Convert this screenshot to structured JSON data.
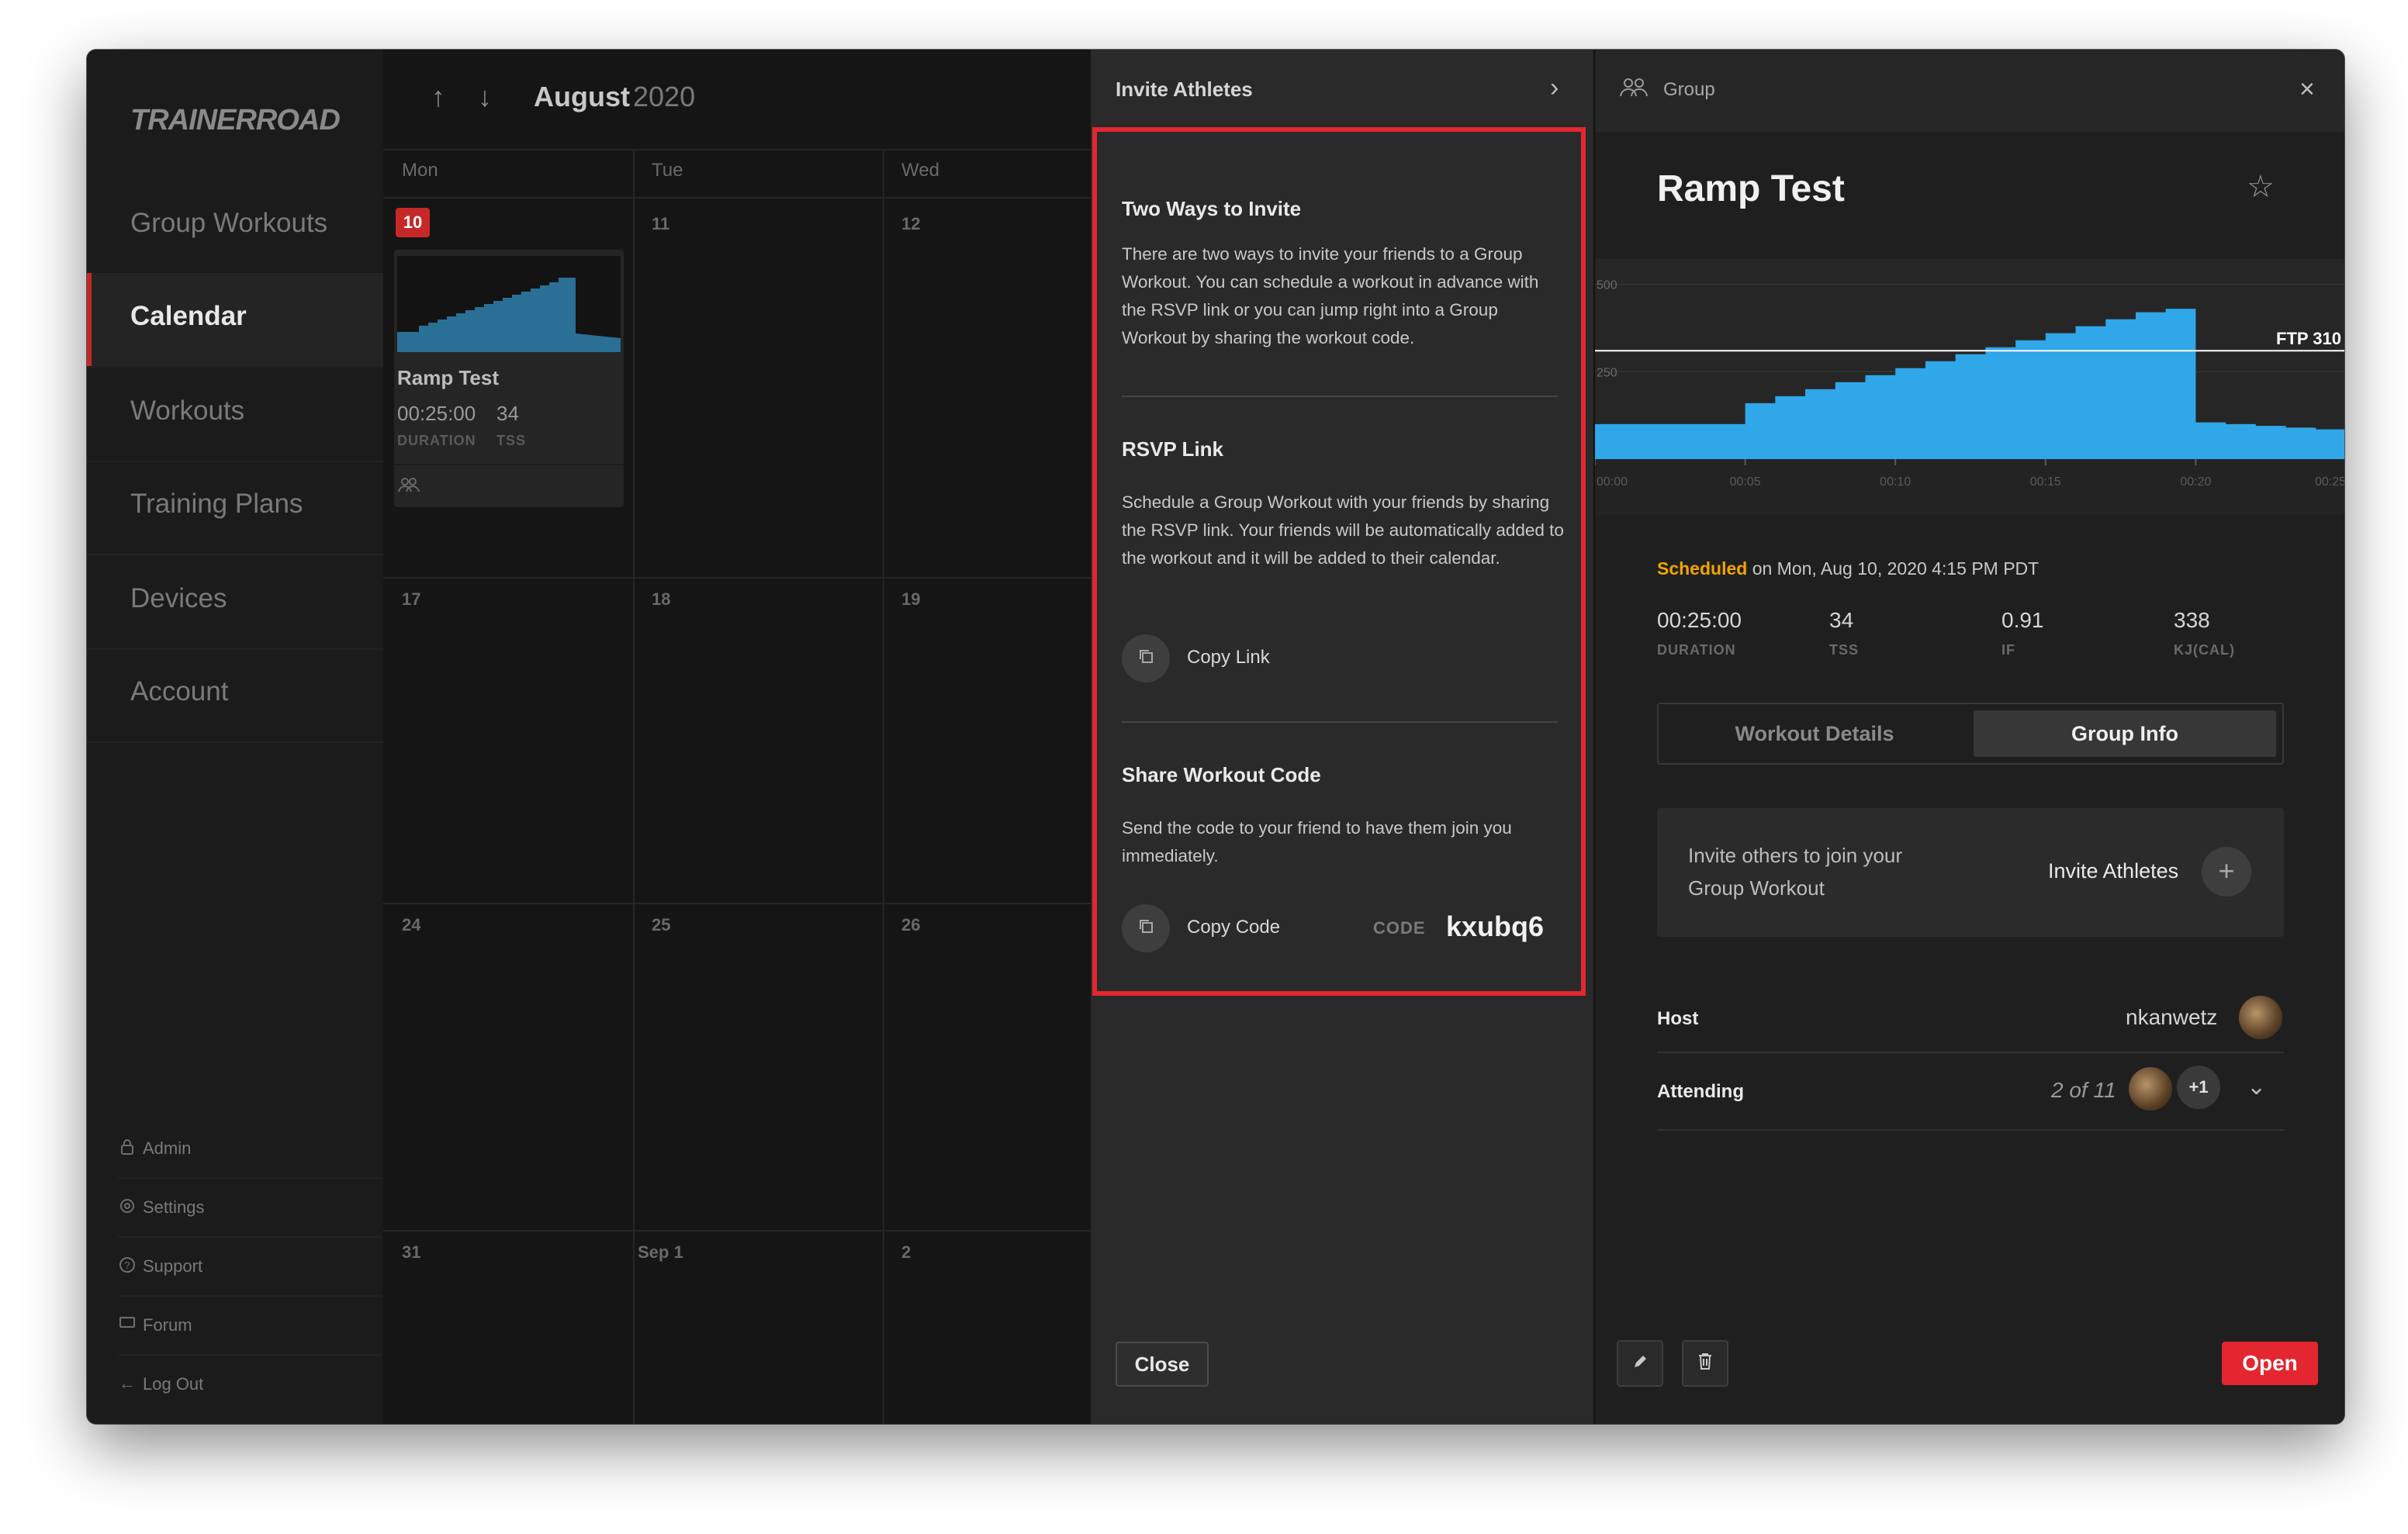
{
  "window": {
    "traffic_lights": [
      "#fe5f57",
      "#febc2e",
      "#28c840"
    ]
  },
  "sidebar": {
    "logo": "TRAINERROAD",
    "nav": [
      {
        "label": "Group Workouts",
        "active": false
      },
      {
        "label": "Calendar",
        "active": true
      },
      {
        "label": "Workouts",
        "active": false
      },
      {
        "label": "Training Plans",
        "active": false
      },
      {
        "label": "Devices",
        "active": false
      },
      {
        "label": "Account",
        "active": false
      }
    ],
    "utility": [
      {
        "label": "Admin",
        "icon": "lock-icon"
      },
      {
        "label": "Settings",
        "icon": "gear-icon"
      },
      {
        "label": "Support",
        "icon": "question-icon"
      },
      {
        "label": "Forum",
        "icon": "chat-icon"
      },
      {
        "label": "Log Out",
        "icon": "arrow-left-icon"
      }
    ]
  },
  "calendar": {
    "month": "August",
    "year": "2020",
    "weekdays": [
      "Mon",
      "Tue",
      "Wed"
    ],
    "weeks": [
      [
        "10",
        "11",
        "12"
      ],
      [
        "17",
        "18",
        "19"
      ],
      [
        "24",
        "25",
        "26"
      ],
      [
        "31",
        "Sep 1",
        "2"
      ]
    ],
    "event": {
      "title": "Ramp Test",
      "duration": "00:25:00",
      "tss": "34",
      "duration_label": "DURATION",
      "tss_label": "TSS"
    }
  },
  "invite": {
    "title": "Invite Athletes",
    "sections": {
      "ways": {
        "heading": "Two Ways to Invite",
        "body": "There are two ways to invite your friends to a Group Workout. You can schedule a workout in advance with the RSVP link or you can jump right into a Group Workout by sharing the workout code."
      },
      "rsvp": {
        "heading": "RSVP Link",
        "body": "Schedule a Group Workout with your friends by sharing the RSVP link. Your friends will be automatically added to the workout and it will be added to their calendar.",
        "button": "Copy Link"
      },
      "code": {
        "heading": "Share Workout Code",
        "body": "Send the code to your friend to have them join you immediately.",
        "button": "Copy Code",
        "code_label": "CODE",
        "code_value": "kxubq6"
      }
    },
    "close": "Close",
    "highlight_color": "#e3262f"
  },
  "detail": {
    "header_label": "Group",
    "title": "Ramp Test",
    "scheduled_word": "Scheduled",
    "scheduled_rest": " on Mon, Aug 10, 2020 4:15 PM PDT",
    "stats": [
      {
        "value": "00:25:00",
        "label": "DURATION"
      },
      {
        "value": "34",
        "label": "TSS"
      },
      {
        "value": "0.91",
        "label": "IF"
      },
      {
        "value": "338",
        "label": "KJ(CAL)"
      }
    ],
    "tabs": [
      {
        "label": "Workout Details",
        "active": false
      },
      {
        "label": "Group Info",
        "active": true
      }
    ],
    "invite_text": "Invite others to join your Group Workout",
    "invite_action": "Invite Athletes",
    "host_label": "Host",
    "host_name": "nkanwetz",
    "attending_label": "Attending",
    "attending_count": "2 of 11",
    "attending_more": "+1",
    "open": "Open"
  },
  "chart_data": {
    "type": "area",
    "title": "",
    "xlabel": "",
    "ylabel": "",
    "x_ticks": [
      "00:00",
      "00:05",
      "00:10",
      "00:15",
      "00:20",
      "00:25"
    ],
    "y_ticks": [
      "500",
      "250"
    ],
    "ylim": [
      0,
      550
    ],
    "xlim": [
      0,
      25
    ],
    "ftp_label": "FTP 310",
    "ftp_value": 310,
    "color": "#2fa7e8",
    "series": [
      {
        "x": [
          0,
          1,
          2,
          3,
          4,
          5,
          6,
          7,
          8,
          9,
          10,
          11,
          12,
          13,
          14,
          15,
          16,
          17,
          18,
          19,
          20,
          21,
          22,
          23,
          24,
          25
        ],
        "values": [
          100,
          100,
          100,
          100,
          100,
          160,
          180,
          200,
          220,
          240,
          260,
          280,
          300,
          320,
          340,
          360,
          380,
          400,
          420,
          430,
          105,
          100,
          95,
          90,
          85,
          80
        ]
      }
    ]
  }
}
